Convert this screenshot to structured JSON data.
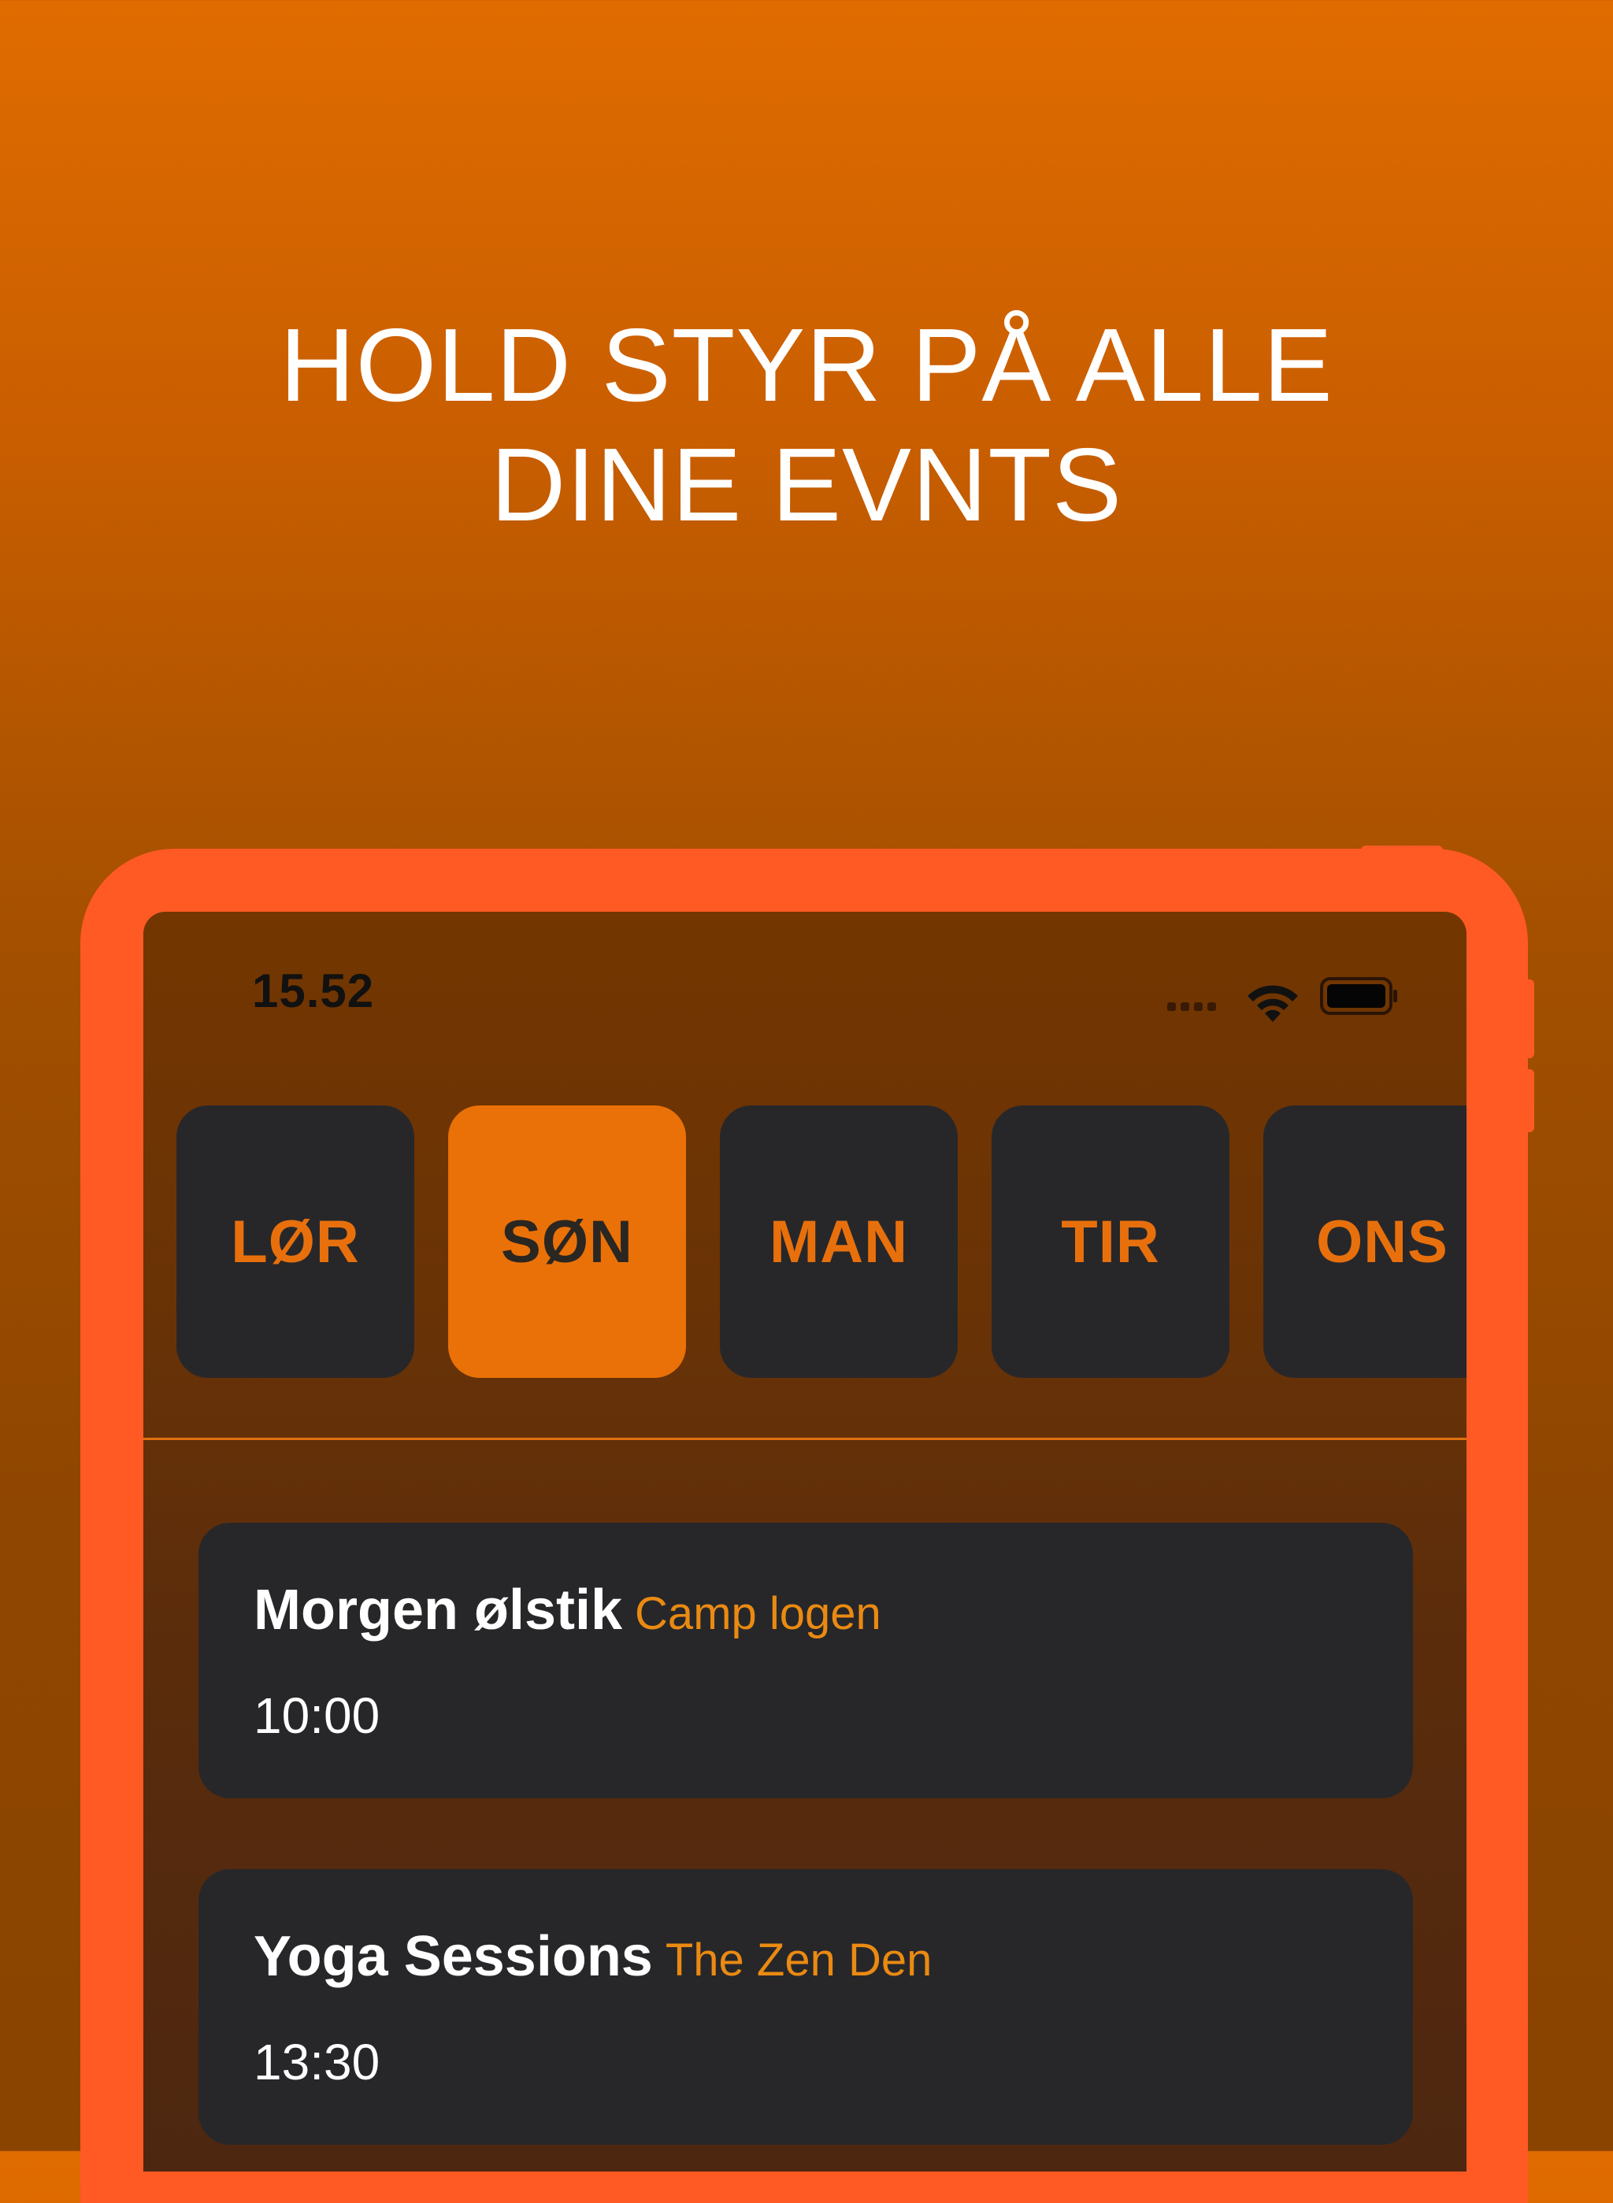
{
  "headline": {
    "line1": "HOLD STYR PÅ ALLE",
    "line2": "DINE EVNTS"
  },
  "status_bar": {
    "time": "15.52",
    "icons": [
      "signal-icon",
      "wifi-icon",
      "battery-icon"
    ]
  },
  "day_tabs": [
    {
      "label": "LØR",
      "active": false
    },
    {
      "label": "SØN",
      "active": true
    },
    {
      "label": "MAN",
      "active": false
    },
    {
      "label": "TIR",
      "active": false
    },
    {
      "label": "ONS",
      "active": false
    }
  ],
  "events": [
    {
      "name": "Morgen ølstik",
      "location": "Camp logen",
      "time": "10:00"
    },
    {
      "name": "Yoga Sessions",
      "location": "The Zen Den",
      "time": "13:30"
    }
  ],
  "colors": {
    "background_top": "#e06c00",
    "background_bottom": "#8a4400",
    "device_frame": "#ff5a24",
    "card": "#27272a",
    "accent": "#ea7107",
    "location_text": "#ea8a12"
  }
}
